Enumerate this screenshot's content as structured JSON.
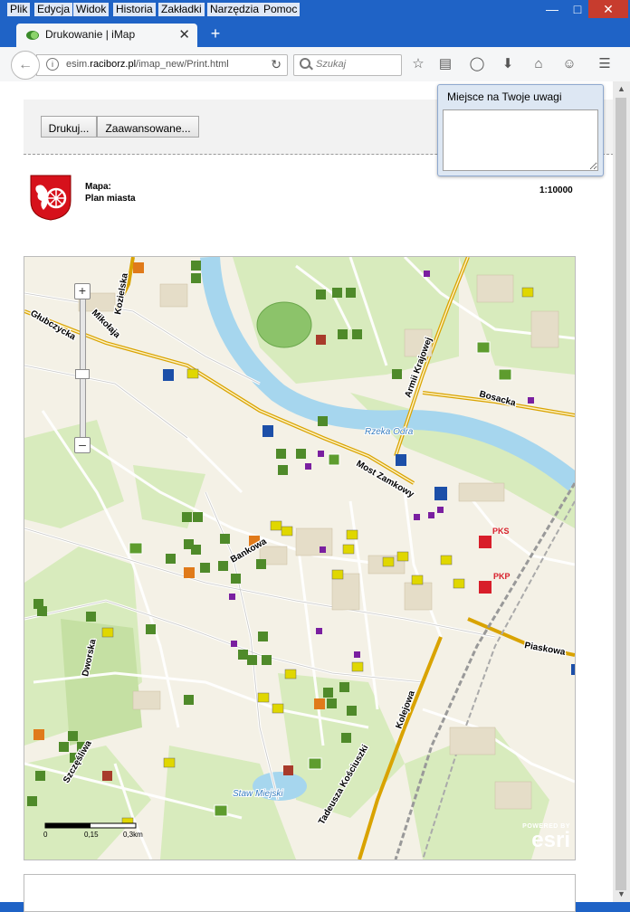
{
  "menu": [
    "Plik",
    "Edycja",
    "Widok",
    "Historia",
    "Zakładki",
    "Narzędzia",
    "Pomoc"
  ],
  "tab": {
    "title": "Drukowanie | iMap"
  },
  "address": {
    "prefix": "esim.",
    "domain": "raciborz.pl",
    "path": "/imap_new/Print.html"
  },
  "search": {
    "placeholder": "Szukaj"
  },
  "toolbar_icons": [
    "star-icon",
    "reading-list-icon",
    "pocket-icon",
    "download-icon",
    "home-icon",
    "hello-icon",
    "hamburger-menu-icon"
  ],
  "print": {
    "print_button": "Drukuj...",
    "advanced_button": "Zaawansowane..."
  },
  "comment": {
    "title": "Miejsce na Twoje uwagi",
    "text": ""
  },
  "map_header": {
    "label": "Mapa:",
    "name": "Plan miasta",
    "scale": "1:10000"
  },
  "map": {
    "labels": {
      "kozielska": "Kozielska",
      "mikolaja": "Mikołaja",
      "glubczycka": "Głubczycka",
      "armii_krajowej": "Armii Krajowej",
      "bosacka": "Bosacka",
      "rzeka_odra": "Rzeka Odra",
      "mostowy": "Most Zamkowy",
      "bankowa": "Bankowa",
      "pks": "PKS",
      "pkp": "PKP",
      "piaskowa": "Piaskowa",
      "dworska": "Dworska",
      "szczesliwa": "Szczęśliwa",
      "kolejowa": "Kolejowa",
      "kosciuszki": "Tadeusza Kościuszki",
      "staw": "Staw Miejski"
    },
    "scalebar": {
      "ticks": [
        "0",
        "0,15",
        "0,3km"
      ]
    },
    "attribution": {
      "small": "POWERED BY",
      "logo": "esri"
    },
    "colors": {
      "river": "#a6d6ee",
      "green": "#dcedc2",
      "road_main": "#d9a300",
      "road": "#ffffff"
    }
  }
}
